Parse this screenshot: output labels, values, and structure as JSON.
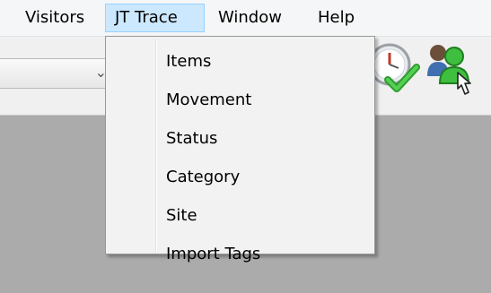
{
  "menubar": {
    "items": [
      {
        "label": "Visitors"
      },
      {
        "label": "JT Trace"
      },
      {
        "label": "Window"
      },
      {
        "label": "Help"
      }
    ]
  },
  "dropdown": {
    "items": [
      {
        "label": "Items"
      },
      {
        "label": "Movement"
      },
      {
        "label": "Status"
      },
      {
        "label": "Category"
      },
      {
        "label": "Site"
      },
      {
        "label": "Import Tags"
      }
    ]
  },
  "toolbar": {
    "icons": [
      "chevron-down-icon",
      "clock-check-icon",
      "users-pointer-icon"
    ]
  },
  "colors": {
    "menu_highlight": "#cce8ff",
    "workspace": "#ababab"
  }
}
